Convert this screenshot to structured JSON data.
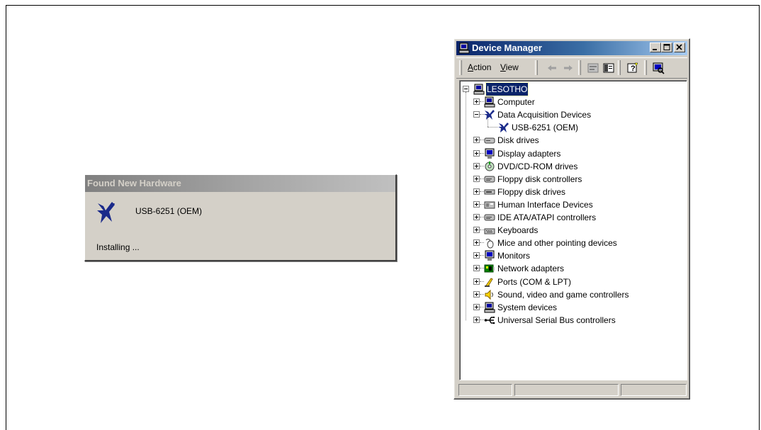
{
  "found_new_hardware": {
    "title": "Found New Hardware",
    "device_name": "USB-6251 (OEM)",
    "status": "Installing ..."
  },
  "device_manager": {
    "title": "Device Manager",
    "menu": {
      "action_hotkey": "A",
      "action_rest": "ction",
      "view_hotkey": "V",
      "view_rest": "iew"
    },
    "toolbar_icons": [
      "back-arrow-icon",
      "forward-arrow-icon",
      "properties-icon",
      "console-tree-icon",
      "help-icon",
      "scan-hardware-icon"
    ],
    "tree": {
      "root": "LESOTHO",
      "categories": [
        {
          "label": "Computer",
          "icon": "computer-icon",
          "expanded": false
        },
        {
          "label": "Data Acquisition Devices",
          "icon": "ni-logo-icon",
          "expanded": true,
          "children": [
            {
              "label": "USB-6251 (OEM)",
              "icon": "ni-logo-icon"
            }
          ]
        },
        {
          "label": "Disk drives",
          "icon": "disk-drive-icon",
          "expanded": false
        },
        {
          "label": "Display adapters",
          "icon": "monitor-icon",
          "expanded": false
        },
        {
          "label": "DVD/CD-ROM drives",
          "icon": "cdrom-icon",
          "expanded": false
        },
        {
          "label": "Floppy disk controllers",
          "icon": "controller-icon",
          "expanded": false
        },
        {
          "label": "Floppy disk drives",
          "icon": "floppy-drive-icon",
          "expanded": false
        },
        {
          "label": "Human Interface Devices",
          "icon": "hid-icon",
          "expanded": false
        },
        {
          "label": "IDE ATA/ATAPI controllers",
          "icon": "controller-icon",
          "expanded": false
        },
        {
          "label": "Keyboards",
          "icon": "keyboard-icon",
          "expanded": false
        },
        {
          "label": "Mice and other pointing devices",
          "icon": "mouse-icon",
          "expanded": false
        },
        {
          "label": "Monitors",
          "icon": "monitor-icon",
          "expanded": false
        },
        {
          "label": "Network adapters",
          "icon": "network-adapter-icon",
          "expanded": false
        },
        {
          "label": "Ports (COM & LPT)",
          "icon": "port-icon",
          "expanded": false
        },
        {
          "label": "Sound, video and game controllers",
          "icon": "sound-icon",
          "expanded": false
        },
        {
          "label": "System devices",
          "icon": "computer-icon",
          "expanded": false
        },
        {
          "label": "Universal Serial Bus controllers",
          "icon": "usb-icon",
          "expanded": false
        }
      ]
    }
  },
  "colors": {
    "titlebar_active_start": "#0a246a",
    "titlebar_active_end": "#a6caf0",
    "window_face": "#d4d0c8",
    "ni_logo": "#1a2a8a"
  }
}
